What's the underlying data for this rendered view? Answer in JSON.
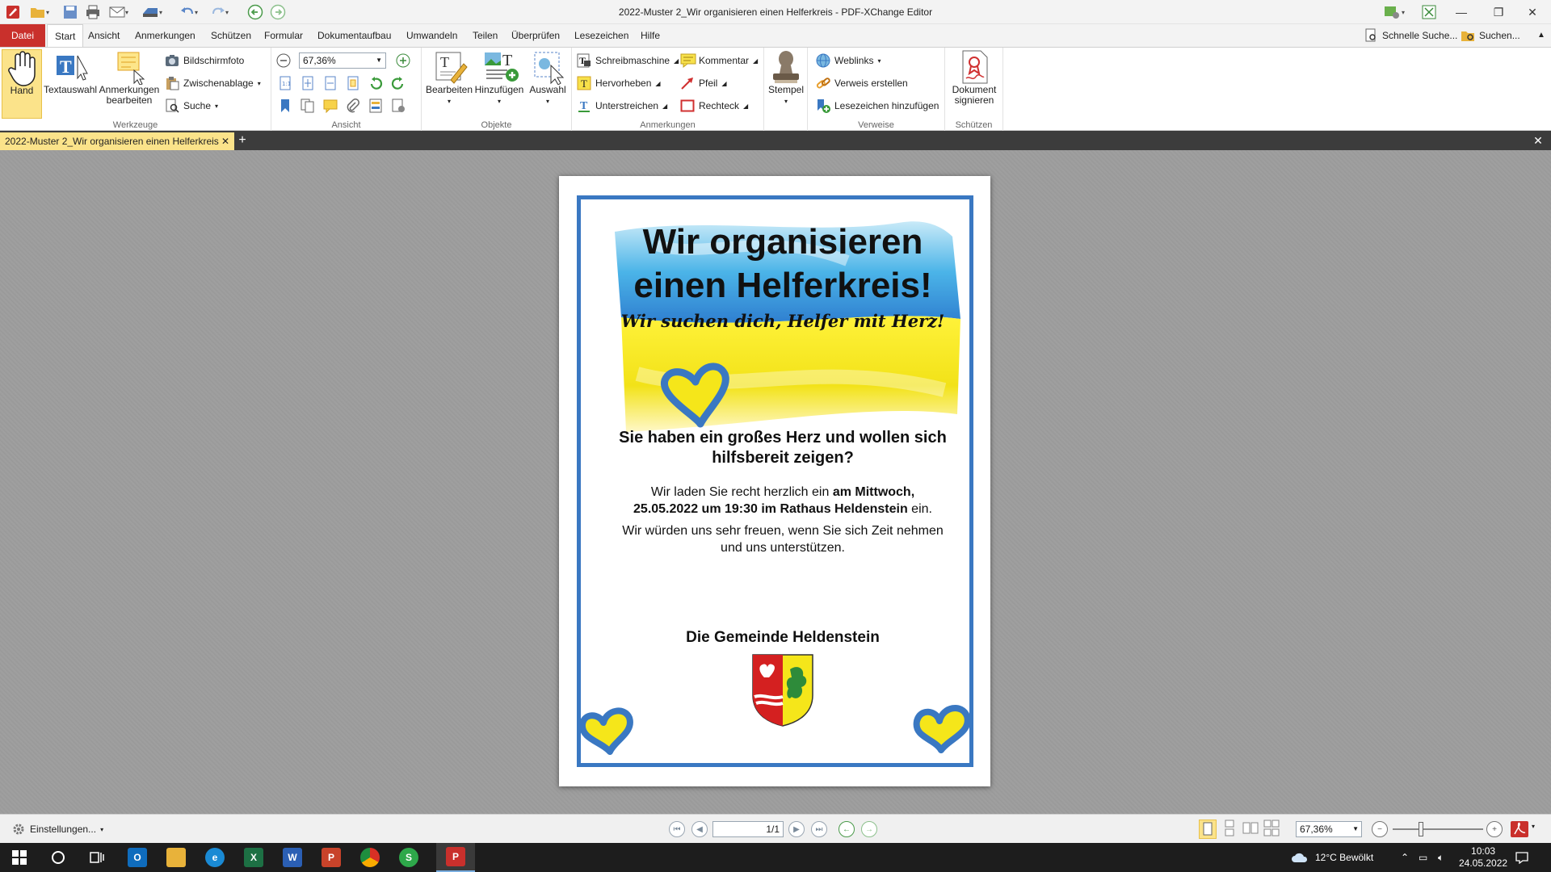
{
  "window": {
    "title": "2022-Muster 2_Wir organisieren einen Helferkreis - PDF-XChange Editor"
  },
  "menu": {
    "items": [
      "Datei",
      "Start",
      "Ansicht",
      "Anmerkungen",
      "Schützen",
      "Formular",
      "Dokumentaufbau",
      "Umwandeln",
      "Teilen",
      "Überprüfen",
      "Lesezeichen",
      "Hilfe"
    ],
    "active": "Start",
    "quick_search": "Schnelle Suche...",
    "search": "Suchen..."
  },
  "ribbon": {
    "werkzeuge": {
      "label": "Werkzeuge",
      "hand": "Hand",
      "textauswahl": "Textauswahl",
      "anmerkungen_line1": "Anmerkungen",
      "anmerkungen_line2": "bearbeiten",
      "bildschirmfoto": "Bildschirmfoto",
      "zwischenablage": "Zwischenablage",
      "suche": "Suche"
    },
    "ansicht": {
      "label": "Ansicht",
      "zoom": "67,36%"
    },
    "objekte": {
      "label": "Objekte",
      "bearbeiten": "Bearbeiten",
      "hinzufuegen": "Hinzufügen",
      "auswahl": "Auswahl"
    },
    "anmerkungen": {
      "label": "Anmerkungen",
      "schreibmaschine": "Schreibmaschine",
      "hervorheben": "Hervorheben",
      "unterstreichen": "Unterstreichen",
      "kommentar": "Kommentar",
      "pfeil": "Pfeil",
      "rechteck": "Rechteck",
      "stempel": "Stempel"
    },
    "verweise": {
      "label": "Verweise",
      "weblinks": "Weblinks",
      "verweis": "Verweis erstellen",
      "lesezeichen": "Lesezeichen hinzufügen"
    },
    "schuetzen": {
      "label": "Schützen",
      "sign_line1": "Dokument",
      "sign_line2": "signieren"
    }
  },
  "tab": {
    "label": "2022-Muster 2_Wir organisieren einen Helferkreis"
  },
  "document": {
    "headline_line1": "Wir organisieren",
    "headline_line2": "einen Helferkreis!",
    "slogan": "Wir suchen dich, Helfer mit Herz!",
    "question_line1": "Sie haben ein großes Herz und wollen sich",
    "question_line2": "hilfsbereit zeigen?",
    "invite_pre": "Wir laden Sie recht herzlich ein ",
    "invite_bold1": "am Mittwoch,",
    "invite_bold2": "25.05.2022 um 19:30 im Rathaus Heldenstein",
    "invite_post": " ein.",
    "support_line1": "Wir würden uns sehr freuen, wenn Sie sich Zeit nehmen",
    "support_line2": "und uns unterstützen.",
    "signature": "Die Gemeinde Heldenstein",
    "colors": {
      "blue": "#3a78c2",
      "yellow": "#f5e61a",
      "frame": "#3a78c2"
    }
  },
  "status": {
    "settings": "Einstellungen...",
    "page": "1/1",
    "zoom": "67,36%"
  },
  "taskbar": {
    "weather": "12°C  Bewölkt",
    "time": "10:03",
    "date": "24.05.2022"
  }
}
